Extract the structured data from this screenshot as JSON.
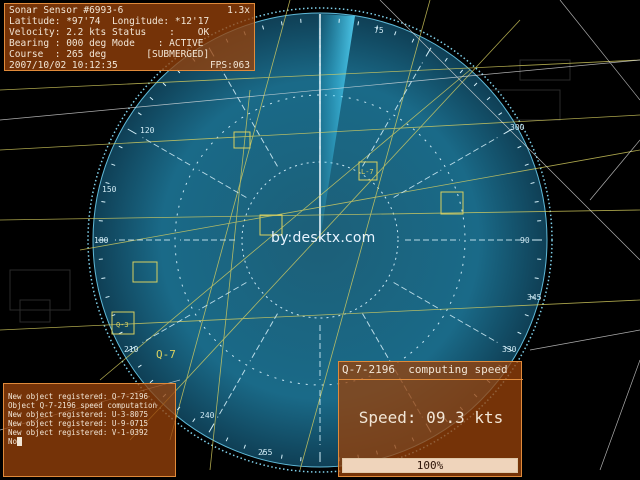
{
  "sensor": {
    "title": "Sonar Sensor #6993-6",
    "zoom": "1.3x",
    "lines": [
      "Latitude: *97'74  Longitude: *12'17",
      "Velocity: 2.2 kts Status    :    OK",
      "Bearing : 000 deg Mode    : ACTIVE",
      "Course  : 265 deg       [SUBMERGED]"
    ],
    "datetime": "2007/10/02 10:12:35",
    "fps": "FPS:063"
  },
  "log": {
    "lines": [
      "New object registered: Q-7-2196",
      "Object Q-7-2196 speed computation",
      "New object registered: U-3-8075",
      "New object registered: U-9-0715",
      "New object registered: V-1-0392",
      "No"
    ]
  },
  "speed": {
    "title": "Q-7-2196  computing speed",
    "value": "Speed: 09.3 kts",
    "progress_label": "100%",
    "progress": 1.0
  },
  "radar": {
    "degree_labels": [
      "75",
      "90",
      "180",
      "210",
      "330",
      "345",
      "240",
      "255"
    ],
    "contacts": [
      "L-7",
      "Q-7",
      "Q-3"
    ],
    "bearing_labels": [
      "120",
      "150",
      "300"
    ]
  },
  "watermark": "by:desktx.com",
  "colors": {
    "panel": "#96410a",
    "radar": "#1f6f8c",
    "grid": "#d8d060",
    "sweep": "#3ad2ff"
  }
}
